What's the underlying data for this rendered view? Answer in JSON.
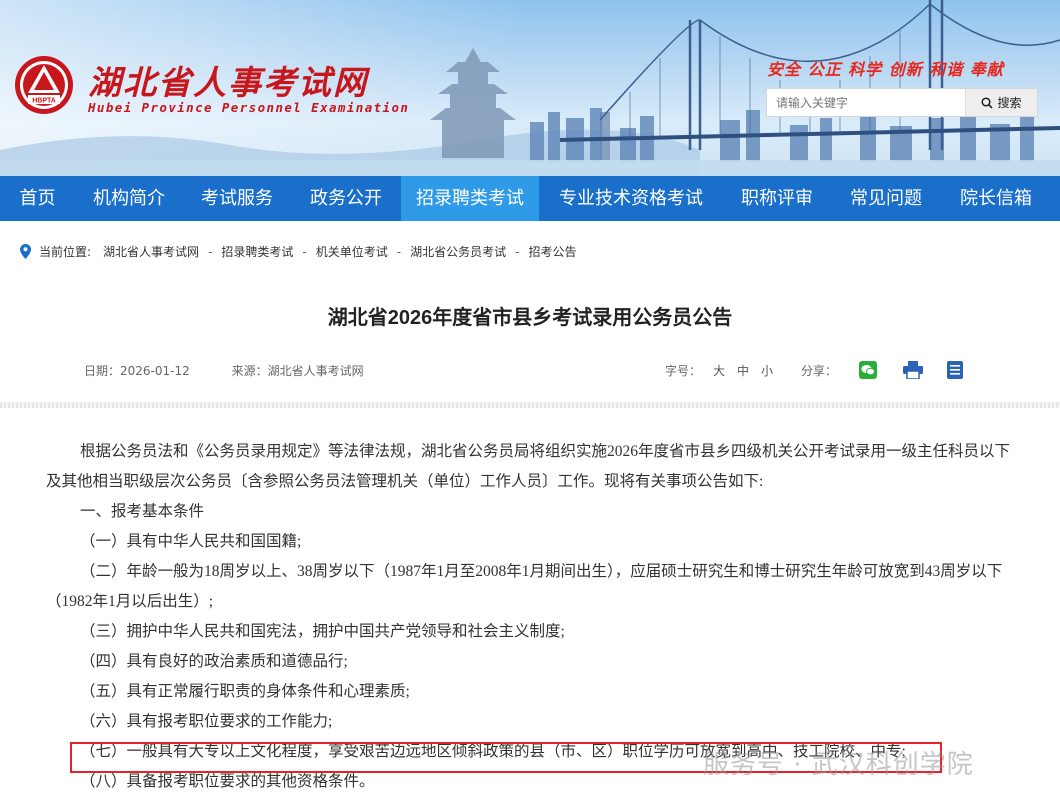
{
  "header": {
    "site_title": "湖北省人事考试网",
    "site_subtitle": "Hubei Province Personnel Examination",
    "logo_text": "HBPTA",
    "slogan": "安全 公正 科学 创新 和谐 奉献",
    "search": {
      "placeholder": "请输入关键字",
      "button_label": "搜索",
      "icon": "search-icon"
    }
  },
  "nav": {
    "items": [
      {
        "label": "首页"
      },
      {
        "label": "机构简介"
      },
      {
        "label": "考试服务"
      },
      {
        "label": "政务公开"
      },
      {
        "label": "招录聘类考试",
        "active": true
      },
      {
        "label": "专业技术资格考试"
      },
      {
        "label": "职称评审"
      },
      {
        "label": "常见问题"
      },
      {
        "label": "院长信箱"
      }
    ]
  },
  "breadcrumb": {
    "label": "当前位置:",
    "items": [
      "湖北省人事考试网",
      "招录聘类考试",
      "机关单位考试",
      "湖北省公务员考试",
      "招考公告"
    ],
    "separator": "-"
  },
  "article": {
    "title": "湖北省2026年度省市县乡考试录用公务员公告",
    "date": "日期：2026-01-12",
    "source": "来源：湖北省人事考试网",
    "font_size_label": "字号：",
    "font_sizes": [
      "大",
      "中",
      "小"
    ],
    "share_label": "分享：",
    "share_icons": [
      "wechat-icon",
      "print-icon",
      "document-icon"
    ],
    "paragraphs": [
      "根据公务员法和《公务员录用规定》等法律法规，湖北省公务员局将组织实施2026年度省市县乡四级机关公开考试录用一级主任科员以下及其他相当职级层次公务员〔含参照公务员法管理机关（单位）工作人员〕工作。现将有关事项公告如下:",
      "一、报考基本条件",
      "（一）具有中华人民共和国国籍;",
      "（二）年龄一般为18周岁以上、38周岁以下（1987年1月至2008年1月期间出生），应届硕士研究生和博士研究生年龄可放宽到43周岁以下（1982年1月以后出生）;",
      "（三）拥护中华人民共和国宪法，拥护中国共产党领导和社会主义制度;",
      "（四）具有良好的政治素质和道德品行;",
      "（五）具有正常履行职责的身体条件和心理素质;",
      "（六）具有报考职位要求的工作能力;",
      "（七）一般具有大专以上文化程度，享受艰苦边远地区倾斜政策的县（市、区）职位学历可放宽到高中、技工院校、中专;",
      "（八）具备报考职位要求的其他资格条件。"
    ]
  },
  "watermark": "服务号 · 武汉科创学院",
  "colors": {
    "nav_bg": "#1a6fcb",
    "nav_active": "#2f9be8",
    "brand_red": "#c8161d",
    "highlight": "#e4232b"
  }
}
